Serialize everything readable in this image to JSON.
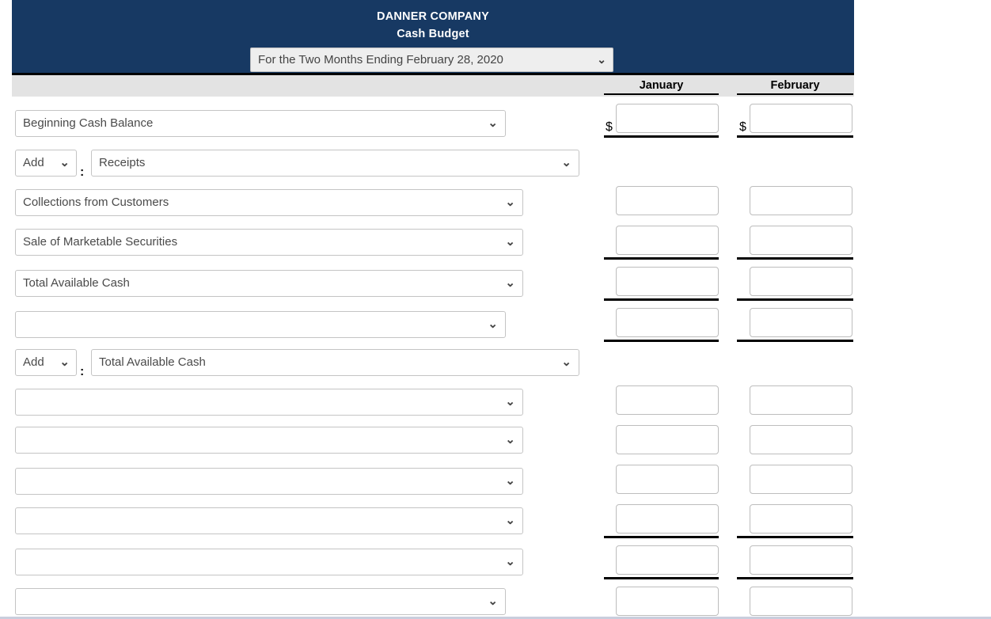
{
  "header": {
    "company": "DANNER COMPANY",
    "statement": "Cash Budget",
    "period_select": {
      "value": "For the Two Months Ending February 28, 2020",
      "caret": "⌄"
    }
  },
  "columns": [
    {
      "key": "january",
      "label": "January"
    },
    {
      "key": "february",
      "label": "February"
    }
  ],
  "currency_symbol": "$",
  "caret_glyph": "⌄",
  "rows": [
    {
      "id": "beginning-cash-balance",
      "kind": "line",
      "label_select": {
        "value": "Beginning Cash Balance"
      },
      "january": {
        "value": "",
        "dollar": true,
        "rule_below": true
      },
      "february": {
        "value": "",
        "dollar": true,
        "rule_below": true
      }
    },
    {
      "id": "add-receipts",
      "kind": "add-section",
      "prefix_select": {
        "value": "Add"
      },
      "separator": ":",
      "label_select": {
        "value": "Receipts"
      },
      "january": null,
      "february": null
    },
    {
      "id": "collections-from-customers",
      "kind": "line",
      "label_select": {
        "value": "Collections from Customers"
      },
      "january": {
        "value": "",
        "dollar": false,
        "rule_below": false
      },
      "february": {
        "value": "",
        "dollar": false,
        "rule_below": false
      }
    },
    {
      "id": "sale-of-marketable-securities",
      "kind": "line",
      "label_select": {
        "value": "Sale of Marketable Securities"
      },
      "january": {
        "value": "",
        "dollar": false,
        "rule_below": true
      },
      "february": {
        "value": "",
        "dollar": false,
        "rule_below": true
      }
    },
    {
      "id": "total-available-cash",
      "kind": "line",
      "label_select": {
        "value": "Total Available Cash"
      },
      "january": {
        "value": "",
        "dollar": false,
        "rule_below": true
      },
      "february": {
        "value": "",
        "dollar": false,
        "rule_below": true
      }
    },
    {
      "id": "blank-line-1",
      "kind": "line",
      "label_select": {
        "value": ""
      },
      "january": {
        "value": "",
        "dollar": false,
        "rule_below": true
      },
      "february": {
        "value": "",
        "dollar": false,
        "rule_below": true
      }
    },
    {
      "id": "add-total-available-cash",
      "kind": "add-section",
      "prefix_select": {
        "value": "Add"
      },
      "separator": ":",
      "label_select": {
        "value": "Total Available Cash"
      },
      "january": null,
      "february": null
    },
    {
      "id": "blank-line-2",
      "kind": "line",
      "label_select": {
        "value": ""
      },
      "january": {
        "value": "",
        "dollar": false,
        "rule_below": false
      },
      "february": {
        "value": "",
        "dollar": false,
        "rule_below": false
      }
    },
    {
      "id": "blank-line-3",
      "kind": "line",
      "label_select": {
        "value": ""
      },
      "january": {
        "value": "",
        "dollar": false,
        "rule_below": false
      },
      "february": {
        "value": "",
        "dollar": false,
        "rule_below": false
      }
    },
    {
      "id": "blank-line-4",
      "kind": "line",
      "label_select": {
        "value": ""
      },
      "january": {
        "value": "",
        "dollar": false,
        "rule_below": false
      },
      "february": {
        "value": "",
        "dollar": false,
        "rule_below": false
      }
    },
    {
      "id": "blank-line-5",
      "kind": "line",
      "label_select": {
        "value": ""
      },
      "january": {
        "value": "",
        "dollar": false,
        "rule_below": true
      },
      "february": {
        "value": "",
        "dollar": false,
        "rule_below": true
      }
    },
    {
      "id": "blank-line-6",
      "kind": "line",
      "label_select": {
        "value": ""
      },
      "january": {
        "value": "",
        "dollar": false,
        "rule_below": true
      },
      "february": {
        "value": "",
        "dollar": false,
        "rule_below": true
      }
    },
    {
      "id": "blank-line-7",
      "kind": "line",
      "label_select": {
        "value": ""
      },
      "january": {
        "value": "",
        "dollar": false,
        "rule_below": false
      },
      "february": {
        "value": "",
        "dollar": false,
        "rule_below": false
      }
    }
  ],
  "colors": {
    "header_navy": "#173963",
    "header_text": "#ffffff",
    "colhead_band": "#e3e3e3",
    "rule": "#000000",
    "field_border": "#c4c4c4",
    "page_background": "#ffffff"
  }
}
